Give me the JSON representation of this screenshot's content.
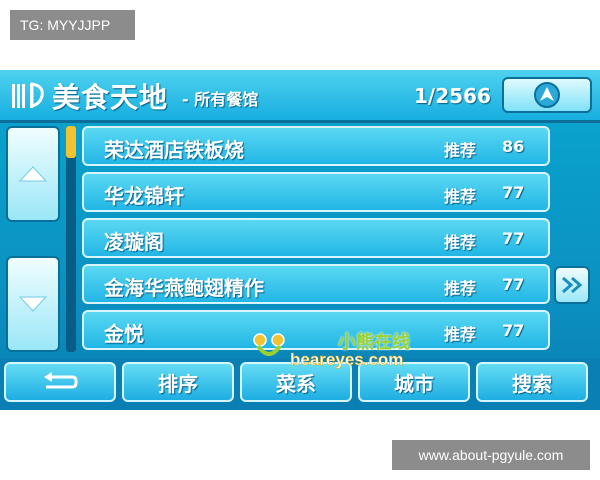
{
  "watermarks": {
    "top_left": "TG: MYYJJPP",
    "bottom_right": "www.about-pgyule.com",
    "site_cn": "小熊在线",
    "site_en": "beareyes.com"
  },
  "header": {
    "title": "美食天地",
    "subtitle": "- 所有餐馆",
    "page_counter": "1/2566",
    "logo_icon": "fork-knife-icon",
    "nav_icon": "navigation-arrow-icon"
  },
  "list": {
    "rows": [
      {
        "name": "荣达酒店铁板烧",
        "tag": "推荐",
        "score": "86"
      },
      {
        "name": "华龙锦轩",
        "tag": "推荐",
        "score": "77"
      },
      {
        "name": "凌璇阁",
        "tag": "推荐",
        "score": "77"
      },
      {
        "name": "金海华燕鲍翅精作",
        "tag": "推荐",
        "score": "77"
      },
      {
        "name": "金悦",
        "tag": "推荐",
        "score": "77"
      }
    ],
    "more_label": "»"
  },
  "toolbar": {
    "back_icon": "back-arrow-icon",
    "sort": "排序",
    "cuisine": "菜系",
    "city": "城市",
    "search": "搜索"
  },
  "colors": {
    "accent": "#17aee0",
    "scroll_thumb": "#f2c230"
  }
}
